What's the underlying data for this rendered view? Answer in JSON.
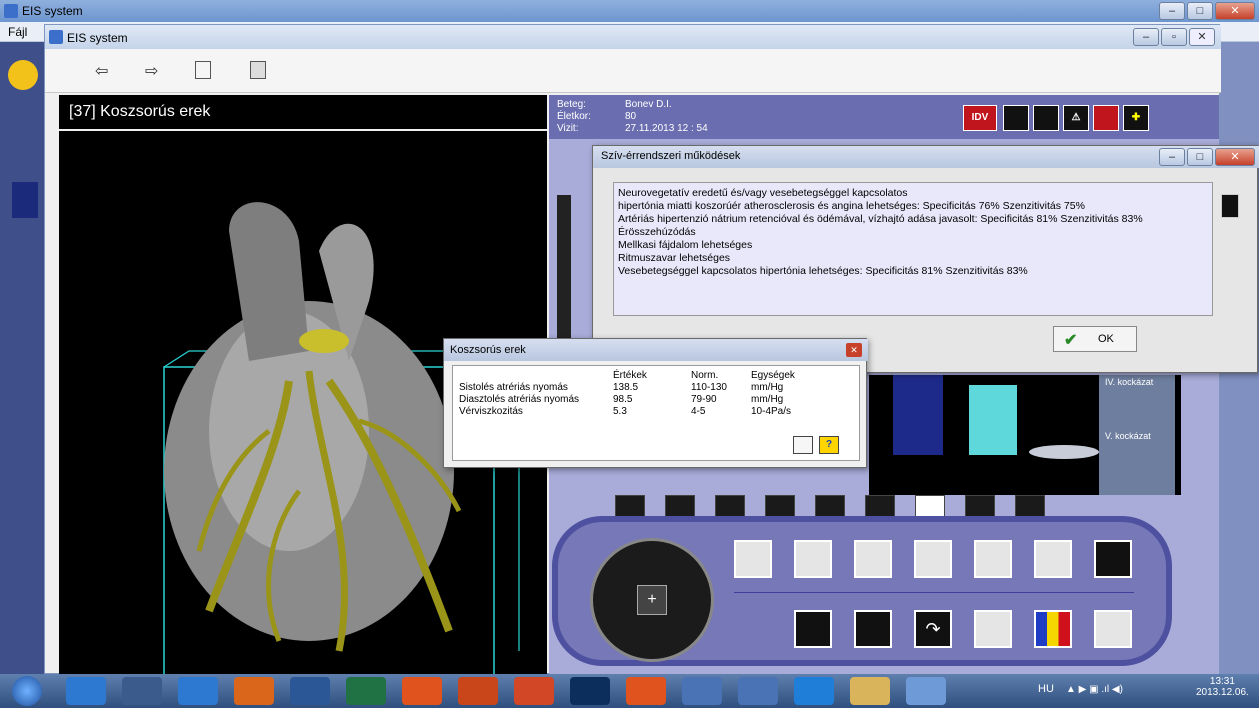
{
  "outer_window": {
    "title": "EIS system",
    "menu": [
      "Fájl"
    ]
  },
  "inner_window": {
    "title": "EIS system"
  },
  "toolbar": {
    "back_label": "⇦",
    "forward_label": "⇨"
  },
  "left_panel": {
    "heading": "[37] Koszsorús erek"
  },
  "patient": {
    "labels": {
      "name": "Beteg:",
      "age": "Életkor:",
      "visit": "Vizit:"
    },
    "name": "Bonev D.I.",
    "age": "80",
    "visit": "27.11.2013  12 : 54",
    "idv_label": "IDV"
  },
  "risk": {
    "iv": "IV. kockázat",
    "v": "V. kockázat"
  },
  "dialog_big": {
    "title": "Szív-érrendszeri működések",
    "lines": [
      "Neurovegetatív eredetű és/vagy vesebetegséggel kapcsolatos",
      "hipertónia miatti koszorúér atherosclerosis és angina lehetséges:  Specificitás 76%  Szenzitivitás 75%",
      "Artériás hipertenzió nátrium retencióval és ödémával, vízhajtó adása javasolt:  Specificitás 81%  Szenzitivitás 83%",
      "Érösszehúzódás",
      "Mellkasi fájdalom lehetséges",
      "Ritmuszavar lehetséges",
      "Vesebetegséggel kapcsolatos hipertónia lehetséges:  Specificitás 81%  Szenzitivitás 83%"
    ],
    "ok_label": "OK"
  },
  "dialog_small": {
    "title": "Koszsorús erek",
    "headers": [
      "Értékek",
      "Norm.",
      "Egységek"
    ],
    "rows": [
      {
        "name": "Sistolés atrériás nyomás",
        "value": "138.5",
        "norm": "110-130",
        "unit": "mm/Hg"
      },
      {
        "name": "Diasztolés atrériás nyomás",
        "value": "98.5",
        "norm": "79-90",
        "unit": "mm/Hg"
      },
      {
        "name": "Vérviszkozitás",
        "value": "5.3",
        "norm": "4-5",
        "unit": "10-4Pa/s"
      }
    ]
  },
  "taskbar": {
    "lang": "HU",
    "time": "13:31",
    "date": "2013.12.06."
  },
  "colors": {
    "panel_purple": "#a9acd9",
    "console": "#7678b8",
    "ok_check": "#2a8a2a"
  }
}
